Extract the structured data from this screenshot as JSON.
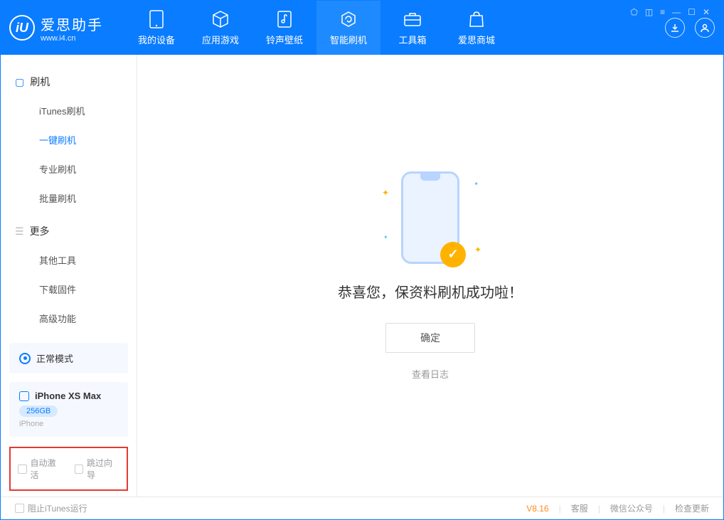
{
  "app": {
    "title": "爱思助手",
    "subtitle": "www.i4.cn",
    "logo_letter": "iU"
  },
  "tabs": [
    {
      "label": "我的设备",
      "icon": "device"
    },
    {
      "label": "应用游戏",
      "icon": "cube"
    },
    {
      "label": "铃声壁纸",
      "icon": "music"
    },
    {
      "label": "智能刷机",
      "icon": "refresh",
      "active": true
    },
    {
      "label": "工具箱",
      "icon": "toolbox"
    },
    {
      "label": "爱思商城",
      "icon": "bag"
    }
  ],
  "sidebar": {
    "sections": [
      {
        "header": "刷机",
        "icon": "phone-icon",
        "items": [
          "iTunes刷机",
          "一键刷机",
          "专业刷机",
          "批量刷机"
        ],
        "active_index": 1
      },
      {
        "header": "更多",
        "icon": "menu-icon",
        "items": [
          "其他工具",
          "下载固件",
          "高级功能"
        ],
        "active_index": -1
      }
    ],
    "mode": "正常模式",
    "device": {
      "name": "iPhone XS Max",
      "storage": "256GB",
      "type": "iPhone"
    },
    "checkboxes": {
      "auto_activate": "自动激活",
      "skip_guide": "跳过向导"
    }
  },
  "main": {
    "success_message": "恭喜您，保资料刷机成功啦！",
    "ok_button": "确定",
    "view_log": "查看日志"
  },
  "statusbar": {
    "block_itunes": "阻止iTunes运行",
    "version": "V8.16",
    "support": "客服",
    "wechat": "微信公众号",
    "check_update": "检查更新"
  }
}
